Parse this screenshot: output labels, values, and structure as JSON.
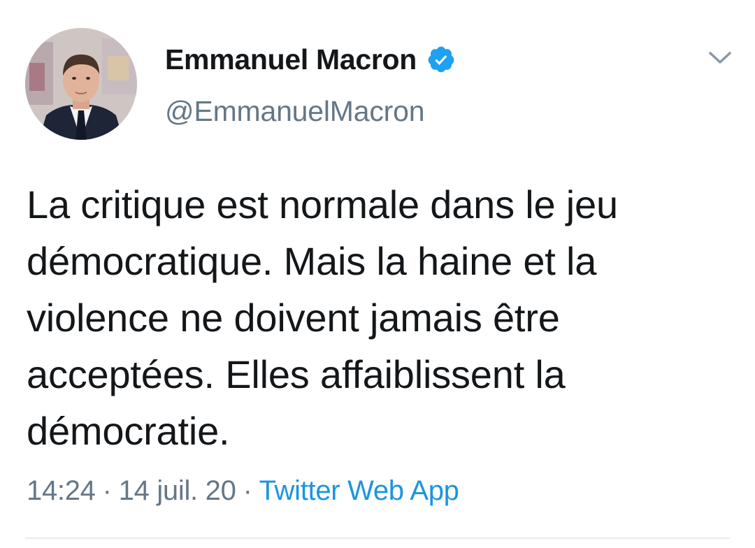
{
  "user": {
    "display_name": "Emmanuel Macron",
    "handle": "@EmmanuelMacron",
    "verified": true,
    "avatar_icon": "profile-photo"
  },
  "tweet": {
    "text": "La critique est normale dans le jeu démocratique. Mais la haine et la violence ne doivent jamais être acceptées. Elles affaiblissent la démocratie.",
    "time": "14:24",
    "date": "14 juil. 20",
    "separator": "·",
    "source": "Twitter Web App"
  },
  "icons": {
    "verified": "verified-badge-icon",
    "menu": "chevron-down-icon"
  },
  "colors": {
    "text": "#14171a",
    "secondary": "#657786",
    "link": "#1b95e0",
    "verified": "#1da1f2",
    "divider": "#e6ecf0"
  }
}
